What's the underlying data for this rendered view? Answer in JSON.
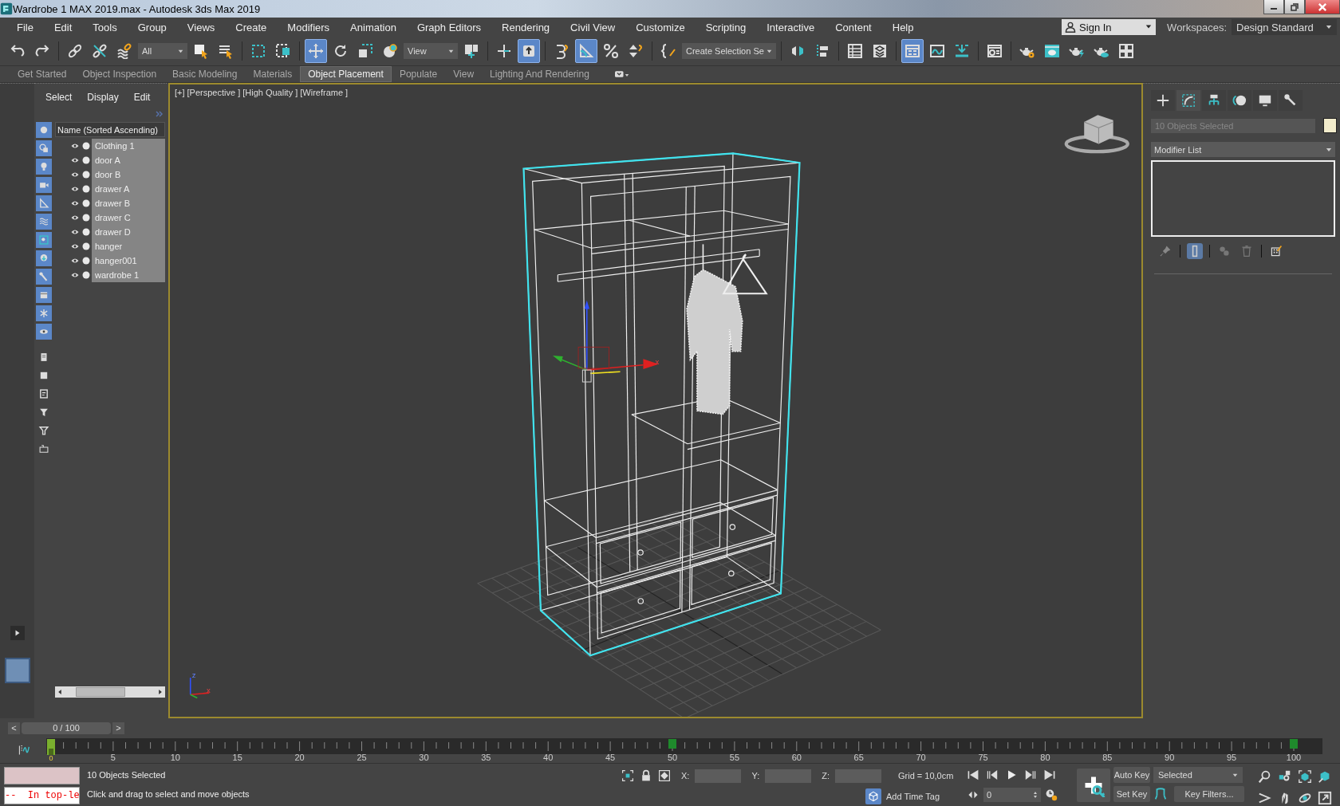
{
  "window": {
    "title": "Wardrobe 1 MAX 2019.max - Autodesk 3ds Max 2019"
  },
  "menu": [
    "File",
    "Edit",
    "Tools",
    "Group",
    "Views",
    "Create",
    "Modifiers",
    "Animation",
    "Graph Editors",
    "Rendering",
    "Civil View",
    "Customize",
    "Scripting",
    "Interactive",
    "Content",
    "Help"
  ],
  "account": {
    "label": "Sign In"
  },
  "workspaces": {
    "label": "Workspaces:",
    "value": "Design Standard"
  },
  "toolbar": {
    "selection_filter": "All",
    "reference_coordinate_system": "View",
    "named_selection_set": "Create Selection Se",
    "buttons": [
      {
        "selected": false
      },
      {
        "selected": false
      },
      {
        "selected": false
      },
      {
        "selected": false
      },
      {
        "selected": false
      },
      {
        "selected": false
      },
      {
        "selected": false
      },
      {
        "selected": false
      },
      {
        "selected": false
      },
      {
        "selected": true
      },
      {
        "selected": false
      },
      {
        "selected": false
      },
      {
        "selected": false
      },
      {
        "selected": false
      },
      {
        "selected": false
      },
      {
        "selected": true
      },
      {
        "selected": false
      },
      {
        "selected": true
      },
      {
        "selected": false
      },
      {
        "selected": false
      },
      {
        "selected": false
      },
      {
        "selected": false
      },
      {
        "selected": false
      },
      {
        "selected": false
      },
      {
        "selected": false
      },
      {
        "selected": true
      },
      {
        "selected": false
      },
      {
        "selected": false
      },
      {
        "selected": false
      },
      {
        "selected": false
      },
      {
        "selected": false
      },
      {
        "selected": false
      },
      {
        "selected": false
      },
      {
        "selected": false
      }
    ]
  },
  "ribbon_tabs": [
    {
      "label": "Get Started",
      "selected": false
    },
    {
      "label": "Object Inspection",
      "selected": false
    },
    {
      "label": "Basic Modeling",
      "selected": false
    },
    {
      "label": "Materials",
      "selected": false
    },
    {
      "label": "Object Placement",
      "selected": true
    },
    {
      "label": "Populate",
      "selected": false
    },
    {
      "label": "View",
      "selected": false
    },
    {
      "label": "Lighting And Rendering",
      "selected": false
    }
  ],
  "scene_explorer": {
    "tabs": [
      "Select",
      "Display",
      "Edit"
    ],
    "column": "Name (Sorted Ascending)",
    "objects": [
      {
        "name": "Clothing 1",
        "selected": true
      },
      {
        "name": "door A",
        "selected": true
      },
      {
        "name": "door B",
        "selected": true
      },
      {
        "name": "drawer A",
        "selected": true
      },
      {
        "name": "drawer B",
        "selected": true
      },
      {
        "name": "drawer C",
        "selected": true
      },
      {
        "name": "drawer D",
        "selected": true
      },
      {
        "name": "hanger",
        "selected": true
      },
      {
        "name": "hanger001",
        "selected": true
      },
      {
        "name": "wardrobe 1",
        "selected": true
      }
    ]
  },
  "viewport": {
    "labels": [
      "[+]",
      "[Perspective ]",
      "[High Quality ]",
      "[Wireframe ]"
    ],
    "active": true,
    "gizmo_label": "x",
    "tripod_labels": [
      "z",
      "x"
    ]
  },
  "command_panel": {
    "tabs": [
      {
        "selected": false
      },
      {
        "selected": true
      },
      {
        "selected": false
      },
      {
        "selected": false
      },
      {
        "selected": false
      },
      {
        "selected": false
      }
    ],
    "selection_name": "10 Objects Selected",
    "modifier_list": "Modifier List"
  },
  "time_slider": {
    "previous": "<",
    "label": "0 / 100",
    "next": ">"
  },
  "track_bar": {
    "cursor_label": "0",
    "labels": [
      {
        "text": "5",
        "key": false
      },
      {
        "text": "10",
        "key": false
      },
      {
        "text": "15",
        "key": false
      },
      {
        "text": "20",
        "key": false
      },
      {
        "text": "25",
        "key": false
      },
      {
        "text": "30",
        "key": false
      },
      {
        "text": "35",
        "key": false
      },
      {
        "text": "40",
        "key": false
      },
      {
        "text": "45",
        "key": false
      },
      {
        "text": "50",
        "key": true
      },
      {
        "text": "55",
        "key": false
      },
      {
        "text": "60",
        "key": false
      },
      {
        "text": "65",
        "key": false
      },
      {
        "text": "70",
        "key": false
      },
      {
        "text": "75",
        "key": false
      },
      {
        "text": "80",
        "key": false
      },
      {
        "text": "85",
        "key": false
      },
      {
        "text": "90",
        "key": false
      },
      {
        "text": "95",
        "key": false
      },
      {
        "text": "100",
        "key": true
      }
    ]
  },
  "status": {
    "maxscript_output": "--  In top-le",
    "selection": "10 Objects Selected",
    "prompt": "Click and drag to select and move objects",
    "coords": [
      {
        "label": "X:"
      },
      {
        "label": "Y:"
      },
      {
        "label": "Z:"
      }
    ],
    "grid": "Grid = 10,0cm",
    "add_time_tag": "Add Time Tag",
    "frame": "0",
    "auto_key": "Auto Key",
    "set_key": "Set Key",
    "key_mode": "Selected",
    "key_filters": "Key Filters..."
  }
}
